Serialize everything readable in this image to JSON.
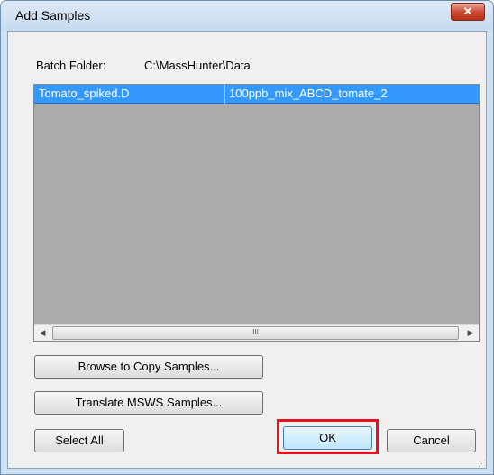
{
  "window": {
    "title": "Add Samples",
    "close_glyph": "✕"
  },
  "batch": {
    "label": "Batch Folder:",
    "path": "C:\\MassHunter\\Data"
  },
  "samples": {
    "rows": [
      {
        "file": "Tomato_spiked.D",
        "name": "100ppb_mix_ABCD_tomate_2",
        "selected": true
      }
    ],
    "scroll_left_glyph": "◀",
    "scroll_right_glyph": "▶",
    "scroll_thumb_glyph": "III"
  },
  "buttons": {
    "browse": "Browse to Copy Samples...",
    "translate": "Translate MSWS Samples...",
    "select_all": "Select All",
    "ok": "OK",
    "cancel": "Cancel"
  },
  "colors": {
    "selection": "#3399ff",
    "list_background": "#ababab",
    "highlight_box": "#e8121b"
  },
  "icons": {
    "close": "close-icon",
    "scroll_left": "chevron-left-icon",
    "scroll_right": "chevron-right-icon",
    "resize": "resize-grip-icon"
  }
}
